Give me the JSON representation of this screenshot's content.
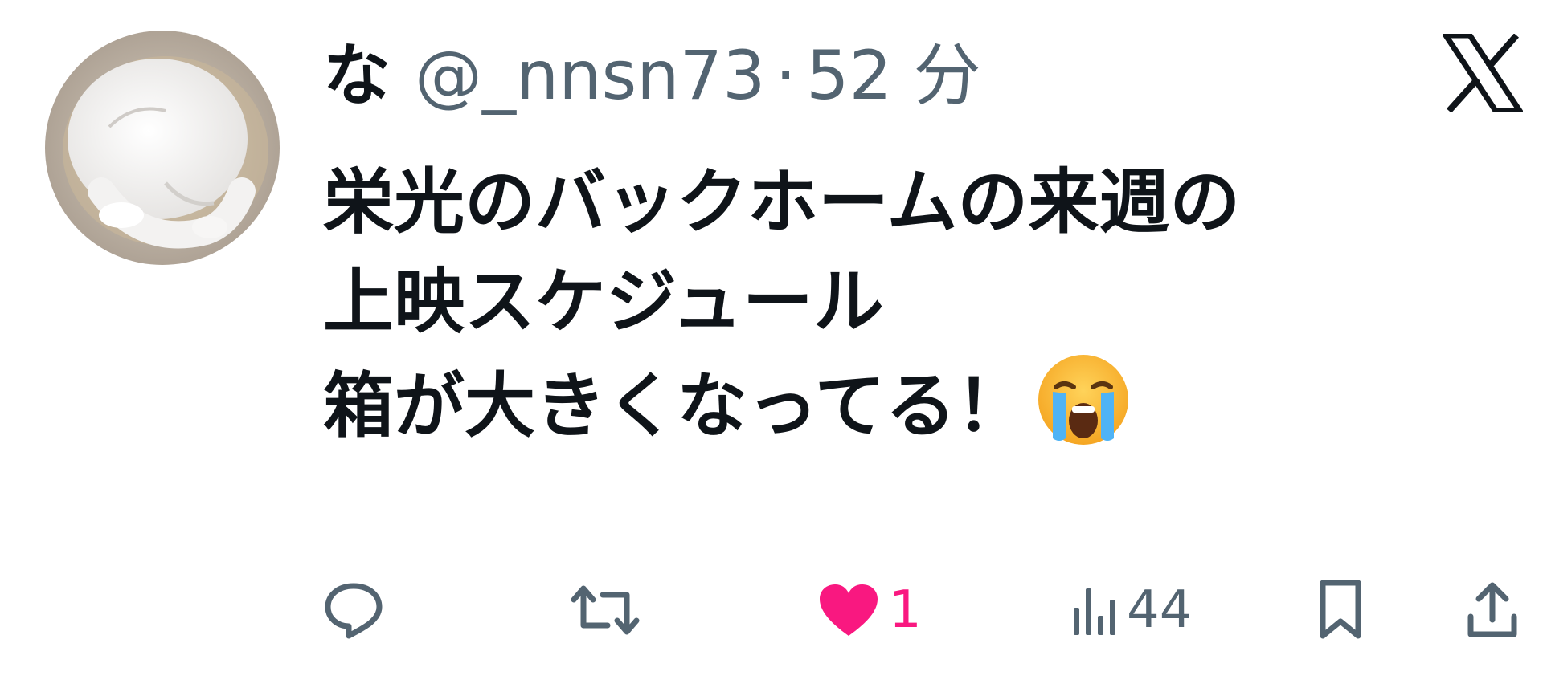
{
  "tweet": {
    "display_name": "な",
    "handle": "@_nnsn73",
    "separator": "·",
    "time": "52 分",
    "text_lines": [
      "栄光のバックホームの来週の",
      "上映スケジュール",
      "箱が大きくなってる！"
    ],
    "emoji": "loudly-crying-face"
  },
  "actions": {
    "reply_count": "",
    "retweet_count": "",
    "like_count": "1",
    "views_count": "44"
  },
  "colors": {
    "text": "#0f1419",
    "secondary": "#536471",
    "like": "#f91880",
    "background": "#ffffff"
  },
  "icons": {
    "avatar": "sleeping-white-cat-avatar",
    "platform": "x-logo-icon",
    "reply": "reply-bubble-icon",
    "retweet": "retweet-icon",
    "like": "heart-filled-icon",
    "views": "views-bar-chart-icon",
    "bookmark": "bookmark-icon",
    "share": "share-upload-icon"
  }
}
